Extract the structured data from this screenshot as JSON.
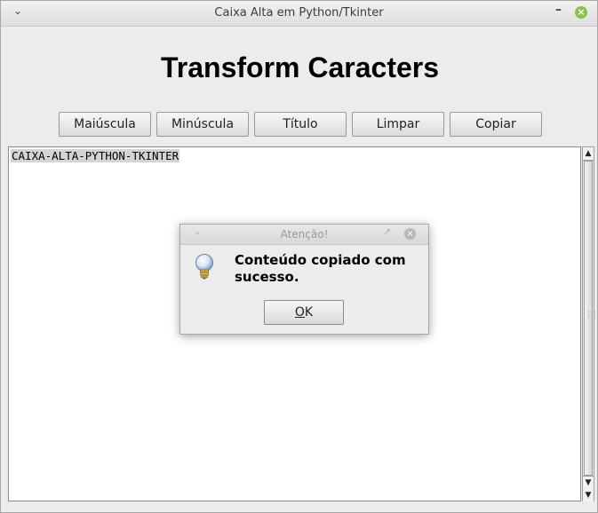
{
  "window": {
    "title": "Caixa Alta em Python/Tkinter",
    "menu_icon": "chevron-down-icon",
    "minimize_icon": "minimize-icon",
    "close_icon": "close-icon"
  },
  "heading": "Transform Caracters",
  "buttons": {
    "upper": "Maiúscula",
    "lower": "Minúscula",
    "title": "Título",
    "clear": "Limpar",
    "copy": "Copiar"
  },
  "textarea": {
    "content": "CAIXA-ALTA-PYTHON-TKINTER"
  },
  "dialog": {
    "title": "Atenção!",
    "message": "Conteúdo copiado com sucesso.",
    "ok_underlined": "O",
    "ok_rest": "K",
    "icon": "lightbulb-icon"
  },
  "colors": {
    "close_button": "#8fbf4f",
    "background": "#ececec",
    "selection": "#d4d4d4"
  }
}
